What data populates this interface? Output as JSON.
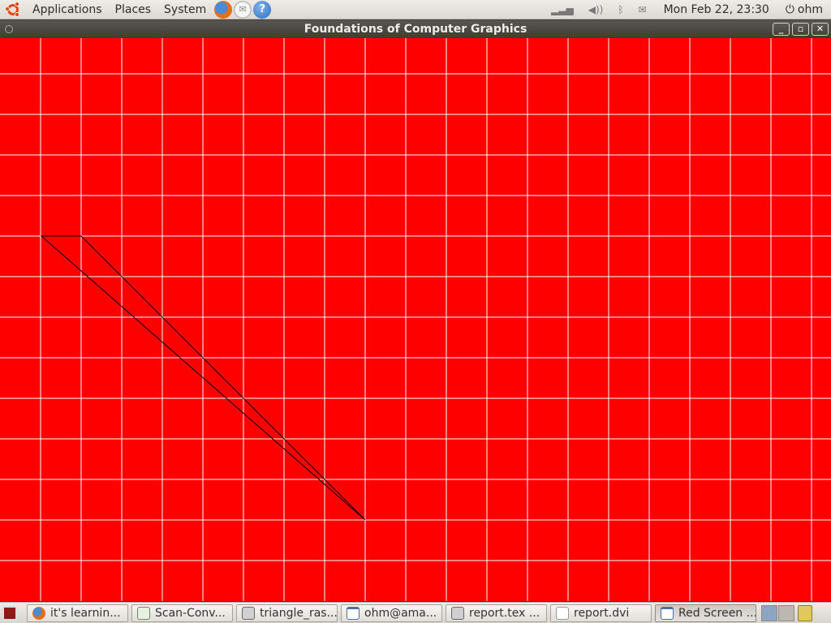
{
  "top_panel": {
    "menus": [
      "Applications",
      "Places",
      "System"
    ],
    "clock": "Mon Feb 22, 23:30",
    "user": "ohm",
    "launchers": [
      {
        "icon": "firefox-icon"
      },
      {
        "icon": "mail-icon"
      },
      {
        "icon": "help-icon",
        "glyph": "?"
      }
    ]
  },
  "window": {
    "title": "Foundations of Computer Graphics",
    "background_color": "#ff0000",
    "grid_color": "#ffffff",
    "outline_color": "#000000"
  },
  "taskbar": {
    "tasks": [
      {
        "label": "it's learnin...",
        "icon": "firefox-icon",
        "active": false
      },
      {
        "label": "Scan-Conv...",
        "icon": "document-icon",
        "active": false
      },
      {
        "label": "triangle_ras...",
        "icon": "gear-icon",
        "active": false
      },
      {
        "label": "ohm@ama...",
        "icon": "terminal-icon",
        "active": false
      },
      {
        "label": "report.tex ...",
        "icon": "gear-icon",
        "active": false
      },
      {
        "label": "report.dvi",
        "icon": "file-icon",
        "active": false
      },
      {
        "label": "Red Screen ...",
        "icon": "terminal-icon",
        "active": true
      }
    ]
  }
}
